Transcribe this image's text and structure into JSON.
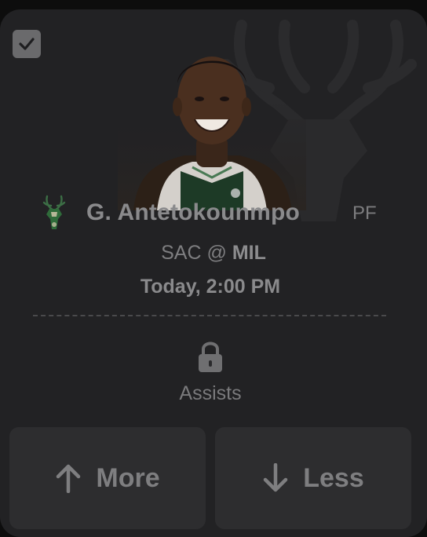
{
  "player": {
    "name": "G. Antetokounmpo",
    "position": "PF",
    "team_logo_icon": "bucks-deer-logo-icon"
  },
  "game": {
    "away": "SAC",
    "at": "@",
    "home": "MIL",
    "time": "Today, 2:00 PM"
  },
  "stat": {
    "label": "Assists",
    "lock_icon": "lock-icon"
  },
  "actions": {
    "more_label": "More",
    "less_label": "Less"
  },
  "colors": {
    "card_bg": "#222224",
    "button_bg": "#2d2d2f",
    "text_muted": "#7e7e80",
    "bucks_green": "#2f6b3a"
  }
}
